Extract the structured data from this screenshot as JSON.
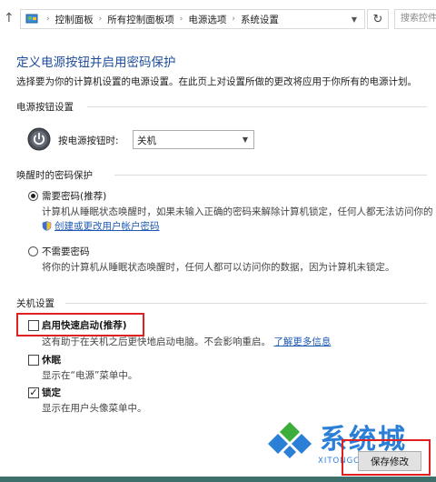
{
  "address_bar": {
    "breadcrumbs": [
      "控制面板",
      "所有控制面板项",
      "电源选项",
      "系统设置"
    ],
    "search_placeholder": "搜索控件"
  },
  "page": {
    "title": "定义电源按钮并启用密码保护",
    "description": "选择要为你的计算机设置的电源设置。在此页上对设置所做的更改将应用于你所有的电源计划。"
  },
  "power_button_settings": {
    "section_label": "电源按钮设置",
    "control_label": "按电源按钮时:",
    "selected_value": "关机"
  },
  "wakeup_password": {
    "section_label": "唤醒时的密码保护",
    "options": [
      {
        "label": "需要密码(推荐)",
        "selected": true,
        "description": "计算机从睡眠状态唤醒时，如果未输入正确的密码来解除计算机锁定，任何人都无法访问你的",
        "link": "创建或更改用户帐户密码"
      },
      {
        "label": "不需要密码",
        "selected": false,
        "description": "将你的计算机从睡眠状态唤醒时，任何人都可以访问你的数据，因为计算机未锁定。"
      }
    ]
  },
  "shutdown_settings": {
    "section_label": "关机设置",
    "items": [
      {
        "label": "启用快速启动(推荐)",
        "checked": false,
        "description": "这有助于在关机之后更快地启动电脑。不会影响重启。",
        "link": "了解更多信息"
      },
      {
        "label": "休眠",
        "checked": false,
        "description": "显示在“电源”菜单中。"
      },
      {
        "label": "锁定",
        "checked": true,
        "description": "显示在用户头像菜单中。"
      }
    ]
  },
  "watermark": {
    "text": "系统城",
    "subtext": "XITONGCHENG.COM"
  },
  "footer": {
    "save_label": "保存修改"
  },
  "colors": {
    "title_blue": "#1e4e9a",
    "link_blue": "#1e5ab4",
    "highlight_red": "#e02020"
  }
}
